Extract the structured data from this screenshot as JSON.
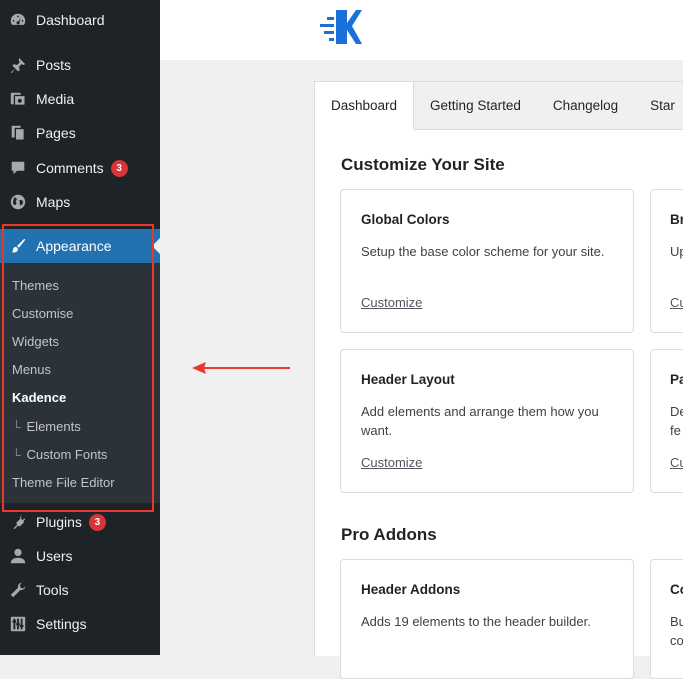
{
  "sidebar": {
    "items": [
      {
        "label": "Dashboard",
        "icon": "dashboard-icon"
      },
      {
        "label": "Posts",
        "icon": "pin-icon"
      },
      {
        "label": "Media",
        "icon": "media-icon"
      },
      {
        "label": "Pages",
        "icon": "pages-icon"
      },
      {
        "label": "Comments",
        "icon": "comments-icon",
        "badge": "3"
      },
      {
        "label": "Maps",
        "icon": "globe-icon"
      },
      {
        "label": "Appearance",
        "icon": "paintbrush-icon",
        "current": true
      },
      {
        "label": "Plugins",
        "icon": "plugin-icon",
        "badge": "3"
      },
      {
        "label": "Users",
        "icon": "user-icon"
      },
      {
        "label": "Tools",
        "icon": "wrench-icon"
      },
      {
        "label": "Settings",
        "icon": "settings-icon"
      }
    ],
    "submenu": [
      {
        "label": "Themes"
      },
      {
        "label": "Customise"
      },
      {
        "label": "Widgets"
      },
      {
        "label": "Menus"
      },
      {
        "label": "Kadence",
        "current": true
      },
      {
        "label": "Elements",
        "branch": "└"
      },
      {
        "label": "Custom Fonts",
        "branch": "└"
      },
      {
        "label": "Theme File Editor"
      }
    ]
  },
  "tabs": [
    {
      "label": "Dashboard",
      "active": true
    },
    {
      "label": "Getting Started"
    },
    {
      "label": "Changelog"
    },
    {
      "label": "Star"
    }
  ],
  "sections": [
    {
      "title": "Customize Your Site",
      "cards": [
        {
          "title": "Global Colors",
          "desc": "Setup the base color scheme for your site.",
          "link": "Customize"
        },
        {
          "title": "Br",
          "desc": "Up",
          "link": "Cu"
        },
        {
          "title": "Header Layout",
          "desc": "Add elements and arrange them how you want.",
          "link": "Customize"
        },
        {
          "title": "Pa",
          "desc": "De fe",
          "link": "Cu"
        }
      ]
    },
    {
      "title": "Pro Addons",
      "cards": [
        {
          "title": "Header Addons",
          "desc": "Adds 19 elements to the header builder."
        },
        {
          "title": "Co",
          "desc": "Bu co"
        }
      ]
    }
  ],
  "colors": {
    "sidebar_bg": "#1d2327",
    "accent": "#2271b1",
    "badge": "#d63638",
    "highlight": "#e8382c",
    "logo": "#1a6fd8"
  }
}
